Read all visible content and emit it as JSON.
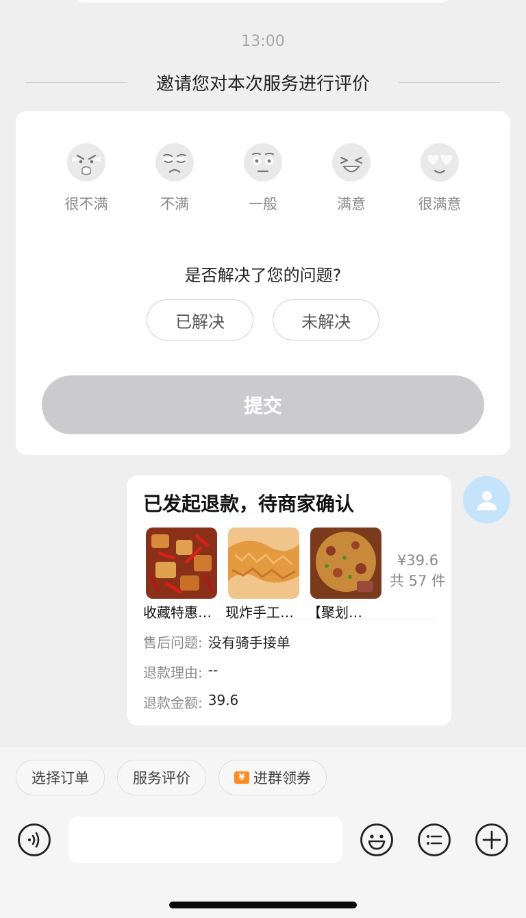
{
  "time": "13:00",
  "invite_text": "邀请您对本次服务进行评价",
  "ratings": [
    {
      "label": "很不满",
      "icon": "very-angry-face-icon"
    },
    {
      "label": "不满",
      "icon": "unhappy-face-icon"
    },
    {
      "label": "一般",
      "icon": "neutral-face-icon"
    },
    {
      "label": "满意",
      "icon": "satisfied-face-icon"
    },
    {
      "label": "很满意",
      "icon": "heart-eyes-face-icon"
    }
  ],
  "question": "是否解决了您的问题?",
  "resolved_label": "已解决",
  "unresolved_label": "未解决",
  "submit_label": "提交",
  "refund": {
    "title": "已发起退款，待商家确认",
    "products": [
      {
        "name": "收藏特惠…"
      },
      {
        "name": "现炸手工…"
      },
      {
        "name": "【聚划…"
      }
    ],
    "price": "¥39.6",
    "count": "共 57 件",
    "issue_label": "售后问题:",
    "issue_value": "没有骑手接单",
    "reason_label": "退款理由:",
    "reason_value": "--",
    "amount_label": "退款金额:",
    "amount_value": "39.6"
  },
  "chips": {
    "select_order": "选择订单",
    "service_rating": "服务评价",
    "join_group": "进群领券",
    "ticket_glyph": "¥"
  },
  "colors": {
    "submit_disabled": "#cbcbcd",
    "avatar_bg": "#c5e4fb",
    "ticket": "#ff8a1f"
  }
}
